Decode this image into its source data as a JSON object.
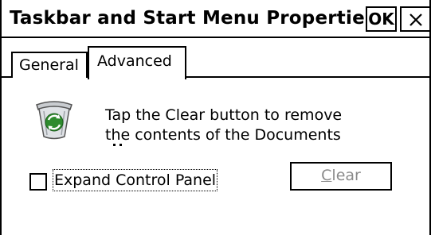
{
  "window": {
    "title": "Taskbar and Start Menu Properties",
    "ok_label": "OK",
    "close_icon": "close-icon"
  },
  "tabs": [
    {
      "label": "General",
      "selected": false
    },
    {
      "label": "Advanced",
      "selected": true
    }
  ],
  "advanced": {
    "icon": "recycle-bin-icon",
    "description_line1": "Tap the Clear button to remove",
    "description_line2": "the contents of the Documents",
    "expand_control_panel": {
      "label": "Expand Control Panel",
      "checked": false
    },
    "clear_button": {
      "mnemonic": "C",
      "label_rest": "lear",
      "enabled": false
    }
  },
  "colors": {
    "background": "#ffffff",
    "foreground": "#000000",
    "disabled_text": "#8a8a8a",
    "icon_green": "#2e8b2e"
  }
}
